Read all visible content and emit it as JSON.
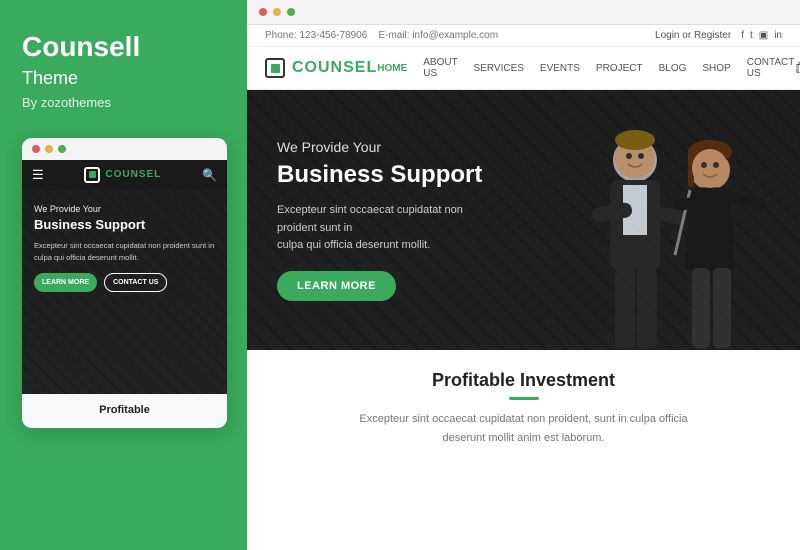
{
  "left": {
    "title": "Counsell",
    "subtitle": "Theme",
    "author": "By zozothemes"
  },
  "phone": {
    "dots": [
      "red",
      "yellow",
      "green"
    ],
    "brand_part1": "COUN",
    "brand_part2": "SEL",
    "hero_tagline": "We Provide Your",
    "hero_title": "Business Support",
    "hero_desc": "Excepteur sint occaecat cupidatat non proident sunt in culpa qui officia deserunt mollit.",
    "btn_learn": "LEARN MORE",
    "btn_contact": "CONTACT US",
    "bottom_title": "Profitable"
  },
  "site": {
    "top_bar": {
      "phone": "Phone: 123-456-78906",
      "email": "E-mail: info@example.com",
      "login": "Login",
      "or": "or",
      "register": "Register"
    },
    "logo_part1": "COUN",
    "logo_part2": "SEL",
    "nav_links": [
      {
        "label": "HOME",
        "active": true
      },
      {
        "label": "ABOUT US",
        "active": false
      },
      {
        "label": "SERVICES",
        "active": false
      },
      {
        "label": "EVENTS",
        "active": false
      },
      {
        "label": "PROJECT",
        "active": false
      },
      {
        "label": "BLOG",
        "active": false
      },
      {
        "label": "SHOP",
        "active": false
      },
      {
        "label": "CONTACT US",
        "active": false
      }
    ],
    "hero": {
      "tagline": "We Provide Your",
      "title": "Business Support",
      "desc_line1": "Excepteur sint occaecat cupidatat non proident sunt in",
      "desc_line2": "culpa qui officia deserunt mollit.",
      "btn": "LEARN MORE"
    },
    "bottom": {
      "title": "Profitable Investment",
      "desc": "Excepteur sint occaecat cupidatat non proident, sunt in culpa officia deserunt mollit anim est laborum."
    }
  }
}
